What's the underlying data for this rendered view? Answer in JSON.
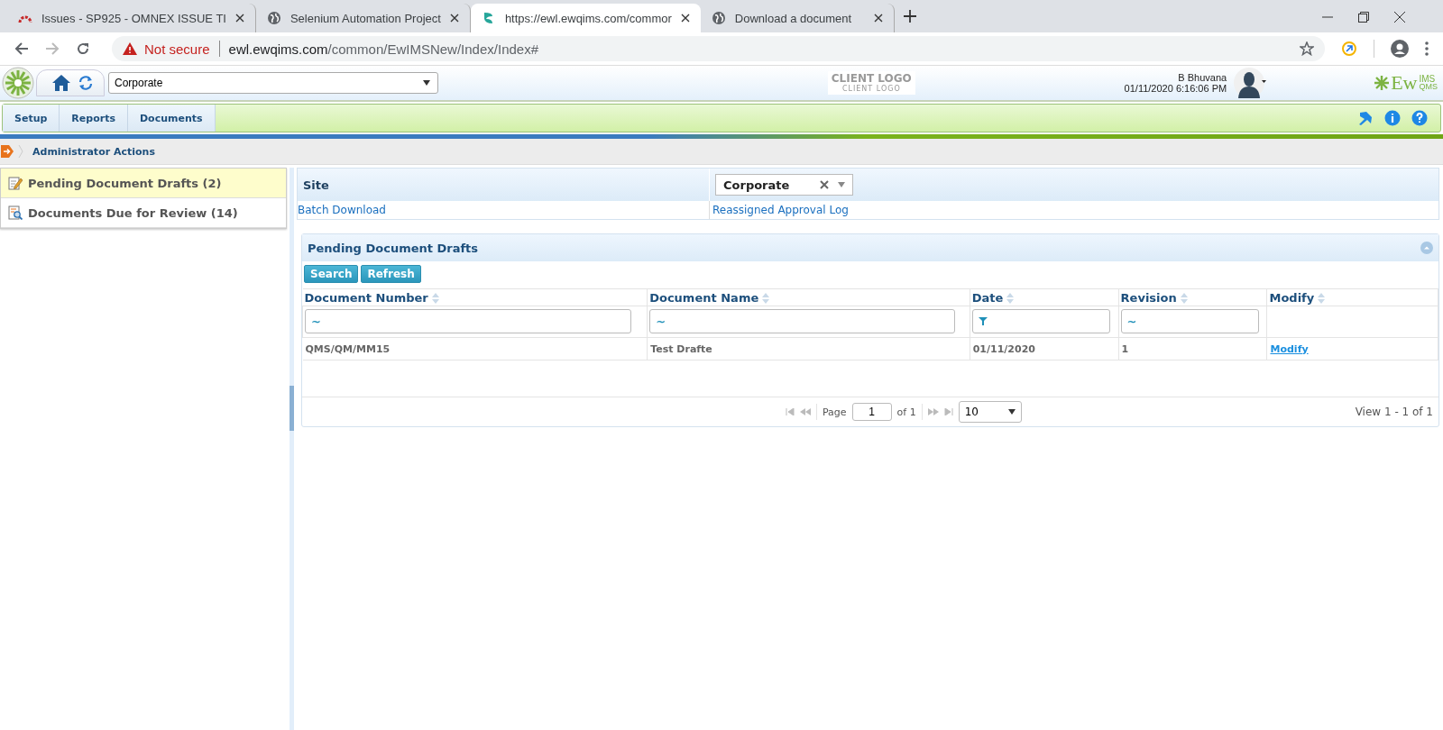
{
  "browser": {
    "tabs": [
      {
        "title": "Issues - SP925 - OMNEX ISSUE TI",
        "selected": false
      },
      {
        "title": "Selenium Automation Project",
        "selected": false
      },
      {
        "title": "https://ewl.ewqims.com/commor",
        "selected": true
      },
      {
        "title": "Download a document",
        "selected": false
      }
    ],
    "security": "Not secure",
    "url_host": "ewl.ewqims.com",
    "url_path": "/common/EwIMSNew/Index/Index#"
  },
  "header": {
    "site_select": "Corporate",
    "client_logo": "CLIENT LOGO",
    "client_logo_sub": "CLIENT LOGO",
    "user": "B Bhuvana",
    "datetime": "01/11/2020 6:16:06 PM",
    "brand": "Ew",
    "brand_sup": "IMS",
    "brand_sub": "QMS"
  },
  "menu": [
    {
      "label": "Setup"
    },
    {
      "label": "Reports"
    },
    {
      "label": "Documents"
    }
  ],
  "breadcrumb": "Administrator Actions",
  "sidebar": {
    "items": [
      {
        "label": "Pending Document Drafts (2)",
        "selected": true
      },
      {
        "label": "Documents Due for Review (14)",
        "selected": false
      }
    ]
  },
  "site_panel": {
    "label": "Site",
    "value": "Corporate",
    "links": [
      "Batch Download",
      "Reassigned Approval Log"
    ]
  },
  "grid": {
    "title": "Pending Document Drafts",
    "buttons": [
      "Search",
      "Refresh"
    ],
    "columns": [
      {
        "label": "Document Number",
        "kind": "text",
        "operator": "~"
      },
      {
        "label": "Document Name",
        "kind": "text",
        "operator": "~"
      },
      {
        "label": "Date",
        "kind": "date"
      },
      {
        "label": "Revision",
        "kind": "text",
        "operator": "~"
      },
      {
        "label": "Modify",
        "kind": "none"
      }
    ],
    "rows": [
      {
        "cells": [
          "QMS/QM/MM15",
          "Test Drafte",
          "01/11/2020",
          "1"
        ],
        "link": "Modify"
      }
    ],
    "pager": {
      "page_label": "Page",
      "page": "1",
      "of": "of 1",
      "page_size": "10",
      "summary": "View 1 - 1 of 1"
    }
  }
}
